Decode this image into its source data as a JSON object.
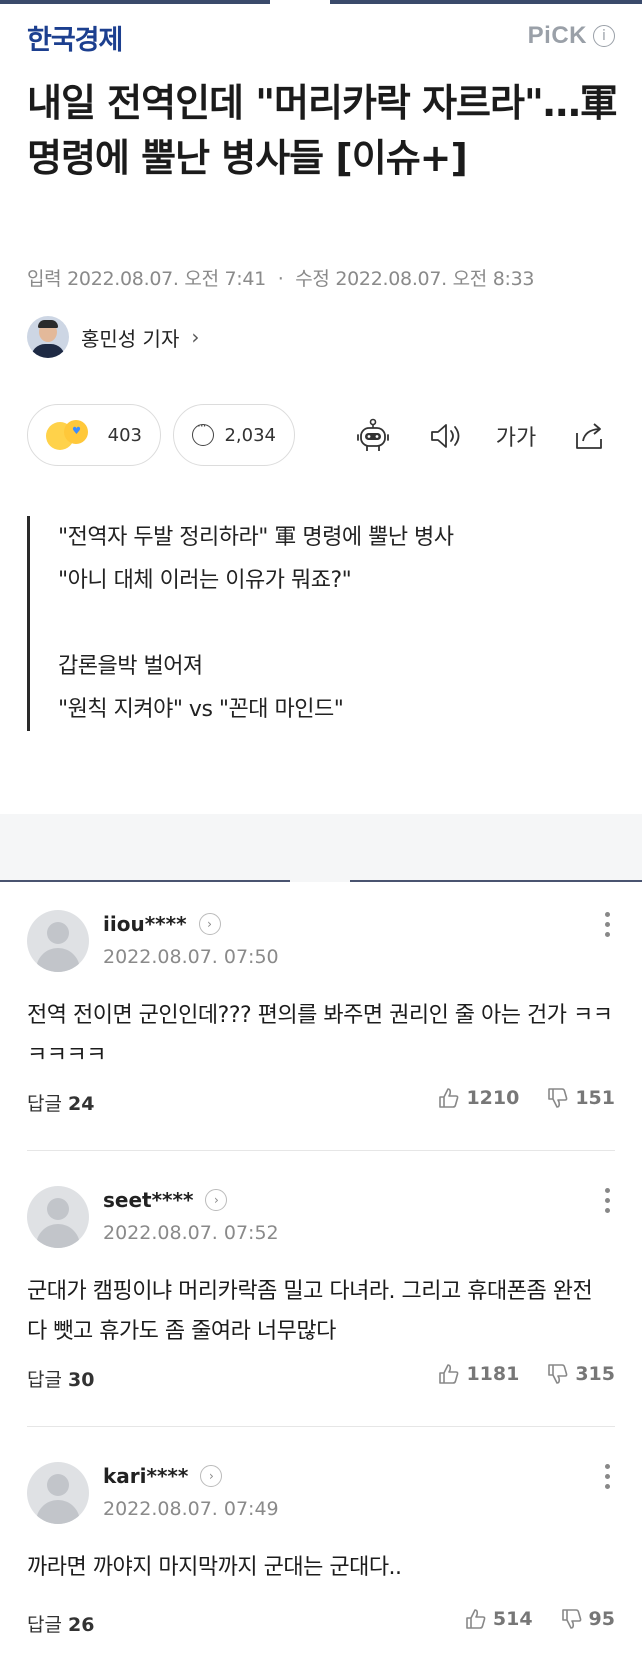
{
  "header": {
    "logo": "한국경제",
    "pick_label": "PiCK",
    "info_glyph": "i"
  },
  "article": {
    "title": "내일 전역인데 \"머리카락 자르라\"…軍 명령에 뿔난 병사들 [이슈+]",
    "input_label": "입력",
    "input_date": "2022.08.07. 오전 7:41",
    "dot": "·",
    "modified_label": "수정",
    "modified_date": "2022.08.07. 오전 8:33",
    "reporter": "홍민성 기자",
    "reporter_chevron": "›"
  },
  "actions": {
    "reactions_count": "403",
    "comments_count": "2,034",
    "font_label": "가가",
    "icons": [
      "reaction-emoji-icon",
      "comment-bubble-icon",
      "robot-summary-icon",
      "speaker-icon",
      "font-size-icon",
      "share-icon"
    ]
  },
  "summary": {
    "lines1": [
      "\"전역자 두발 정리하라\" 軍 명령에 뿔난 병사",
      "\"아니 대체 이러는 이유가 뭐죠?\""
    ],
    "lines2": [
      "갑론을박 벌어져",
      "\"원칙 지켜야\" vs \"꼰대 마인드\""
    ]
  },
  "comments": [
    {
      "user": "iiou****",
      "date": "2022.08.07. 07:50",
      "text": "전역 전이면 군인인데??? 편의를 봐주면 권리인 줄 아는 건가 ㅋㅋㅋㅋㅋㅋ",
      "reply_label": "답글",
      "replies": "24",
      "likes": "1210",
      "dislikes": "151"
    },
    {
      "user": "seet****",
      "date": "2022.08.07. 07:52",
      "text": "군대가 캠핑이냐 머리카락좀 밀고 다녀라. 그리고 휴대폰좀 완전 다 뺏고 휴가도 좀 줄여라 너무많다",
      "reply_label": "답글",
      "replies": "30",
      "likes": "1181",
      "dislikes": "315"
    },
    {
      "user": "kari****",
      "date": "2022.08.07. 07:49",
      "text": "까라면 까야지 마지막까지 군대는 군대다..",
      "reply_label": "답글",
      "replies": "26",
      "likes": "514",
      "dislikes": "95"
    }
  ],
  "colors": {
    "logo": "#1c3f8f",
    "accent_line": "#3a4a6b",
    "muted": "#8a8a8a"
  }
}
